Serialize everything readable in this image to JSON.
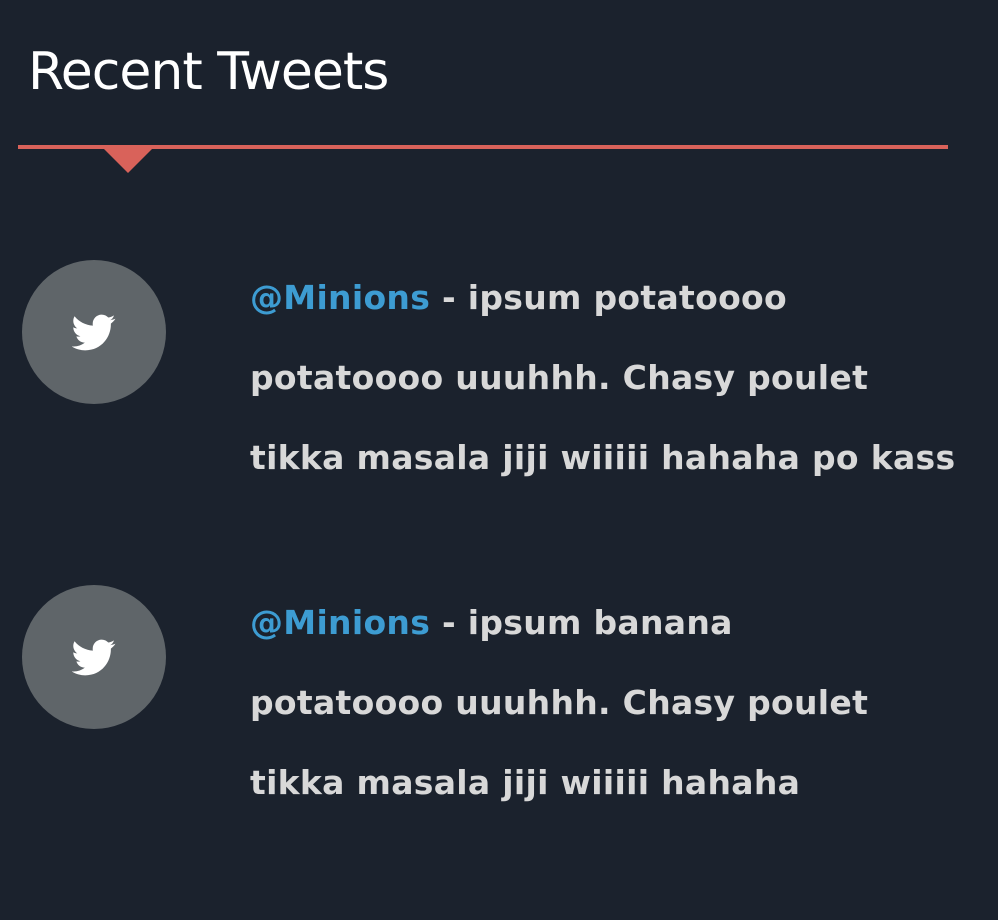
{
  "widget": {
    "title": "Recent Tweets"
  },
  "colors": {
    "background": "#1b222d",
    "accent": "#d9625a",
    "handle": "#3d9cd2",
    "avatar": "#5f6569",
    "text": "#d8d8d8"
  },
  "tweets": [
    {
      "icon": "twitter-bird-icon",
      "handle": "@Minions",
      "separator": " - ",
      "lines": [
        "ipsum potatoooo",
        "potatoooo uuuhhh. Chasy poulet",
        "tikka masala jiji wiiiii hahaha po kass"
      ]
    },
    {
      "icon": "twitter-bird-icon",
      "handle": "@Minions",
      "separator": " - ",
      "lines": [
        "ipsum banana",
        "potatoooo uuuhhh. Chasy poulet",
        "tikka masala jiji wiiiii hahaha"
      ]
    }
  ]
}
